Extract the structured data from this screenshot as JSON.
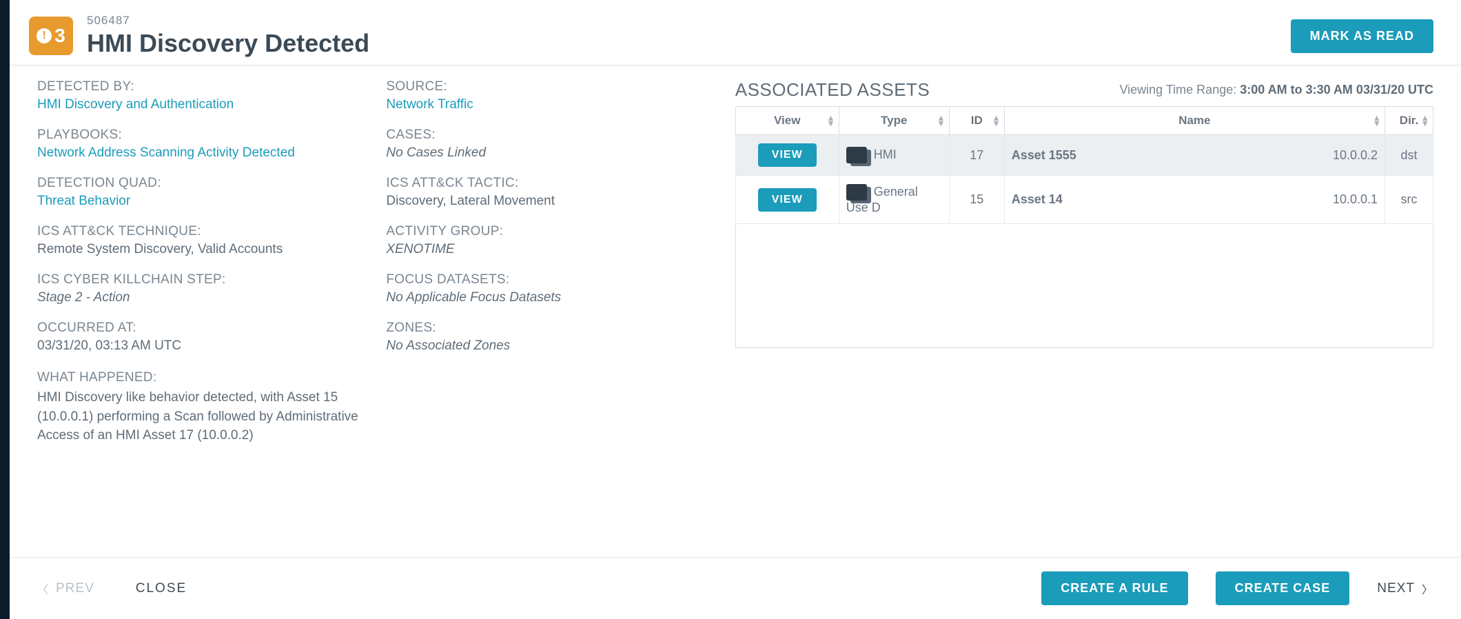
{
  "header": {
    "severity_badge": "3",
    "record_id": "506487",
    "title": "HMI Discovery Detected",
    "mark_read": "MARK AS READ"
  },
  "meta": {
    "detected_by": {
      "label": "DETECTED BY:",
      "value": "HMI Discovery and Authentication",
      "style": "link"
    },
    "playbooks": {
      "label": "PLAYBOOKS:",
      "value": "Network Address Scanning Activity Detected",
      "style": "link"
    },
    "detection_quad": {
      "label": "DETECTION QUAD:",
      "value": "Threat Behavior",
      "style": "link"
    },
    "technique": {
      "label": "ICS ATT&CK TECHNIQUE:",
      "value": "Remote System Discovery, Valid Accounts"
    },
    "killchain": {
      "label": "ICS CYBER KILLCHAIN STEP:",
      "value": "Stage 2 - Action",
      "style": "italic"
    },
    "occurred": {
      "label": "OCCURRED AT:",
      "value": "03/31/20, 03:13 AM UTC"
    },
    "source": {
      "label": "SOURCE:",
      "value": "Network Traffic",
      "style": "link"
    },
    "cases": {
      "label": "CASES:",
      "value": "No Cases Linked",
      "style": "italic"
    },
    "tactic": {
      "label": "ICS ATT&CK TACTIC:",
      "value": "Discovery, Lateral Movement"
    },
    "activity_group": {
      "label": "ACTIVITY GROUP:",
      "value": "XENOTIME",
      "style": "italic"
    },
    "focus": {
      "label": "FOCUS DATASETS:",
      "value": "No Applicable Focus Datasets",
      "style": "italic"
    },
    "zones": {
      "label": "ZONES:",
      "value": "No Associated Zones",
      "style": "italic"
    },
    "what_happened": {
      "label": "WHAT HAPPENED:",
      "value": "HMI Discovery like behavior detected, with Asset 15 (10.0.0.1) performing a Scan followed by Administrative Access of an HMI Asset 17 (10.0.0.2)"
    }
  },
  "assets": {
    "heading": "ASSOCIATED ASSETS",
    "time_range_label": "Viewing Time Range: ",
    "time_range_value": "3:00 AM to 3:30 AM 03/31/20 UTC",
    "columns": {
      "view": "View",
      "type": "Type",
      "id": "ID",
      "name": "Name",
      "dir": "Dir."
    },
    "view_btn": "VIEW",
    "rows": [
      {
        "type": "HMI",
        "id": "17",
        "name": "Asset 1555",
        "ip": "10.0.0.2",
        "dir": "dst",
        "highlight": true
      },
      {
        "type": "General Use D",
        "id": "15",
        "name": "Asset 14",
        "ip": "10.0.0.1",
        "dir": "src",
        "highlight": false
      }
    ]
  },
  "footer": {
    "prev": "PREV",
    "close": "CLOSE",
    "create_rule": "CREATE A RULE",
    "create_case": "CREATE CASE",
    "next": "NEXT"
  }
}
